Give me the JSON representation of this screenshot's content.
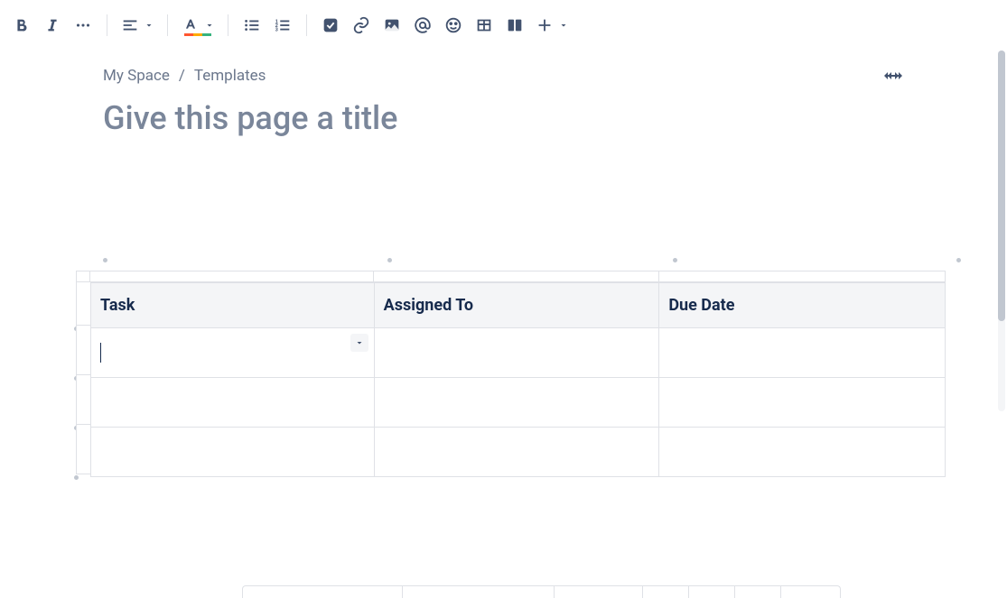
{
  "toolbar": {
    "bold": "B",
    "italic": "I"
  },
  "breadcrumb": {
    "items": [
      "My Space",
      "Templates"
    ],
    "separator": "/"
  },
  "title": {
    "placeholder": "Give this page a title",
    "value": ""
  },
  "table": {
    "headers": [
      "Task",
      "Assigned To",
      "Due Date"
    ],
    "rows": [
      {
        "task": "",
        "assigned": "",
        "due": ""
      },
      {
        "task": "",
        "assigned": "",
        "due": ""
      },
      {
        "task": "",
        "assigned": "",
        "due": ""
      }
    ]
  },
  "colors": {
    "text": "#172b4d",
    "muted": "#6b778c",
    "border": "#dfe1e6",
    "headerBg": "#f4f5f7"
  }
}
